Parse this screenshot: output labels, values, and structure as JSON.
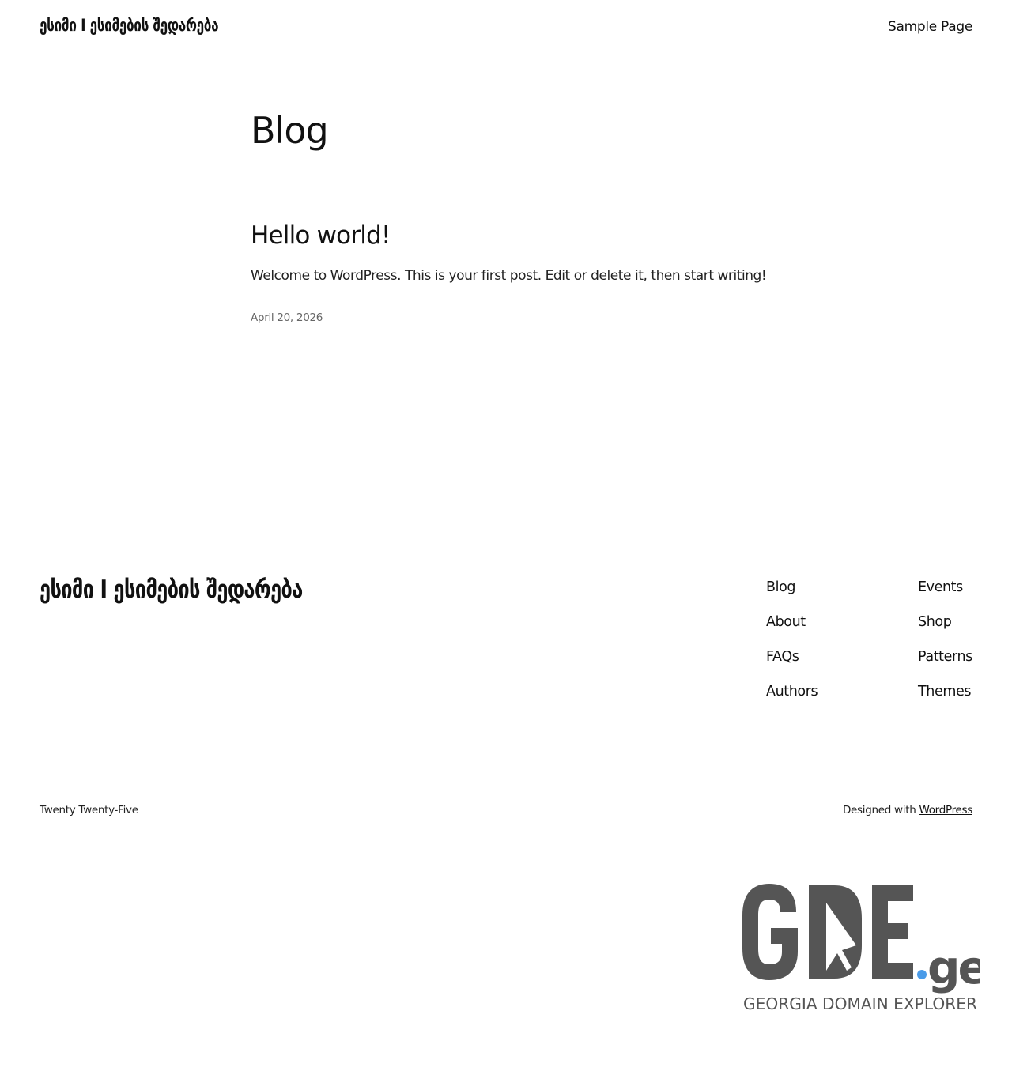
{
  "header": {
    "site_title": "ესიმი I ესიმების შედარება",
    "nav_item": "Sample Page"
  },
  "main": {
    "heading": "Blog",
    "post": {
      "title": "Hello world!",
      "excerpt": "Welcome to WordPress. This is your first post. Edit or delete it, then start writing!",
      "date": "April 20, 2026"
    }
  },
  "footer": {
    "site_title": "ესიმი I ესიმების შედარება",
    "nav_col_1": [
      "Blog",
      "About",
      "FAQs",
      "Authors"
    ],
    "nav_col_2": [
      "Events",
      "Shop",
      "Patterns",
      "Themes"
    ],
    "theme_credit": "Twenty Twenty-Five",
    "designed_with_text": "Designed with",
    "designed_with_link": "WordPress"
  },
  "logo": {
    "letters": "GDE",
    "dot": ".",
    "tld": "ge",
    "tagline": "GEORGIA DOMAIN EXPLORER",
    "primary_color": "#555555",
    "accent_color": "#4a9be8",
    "icon": "cursor-arrow-icon"
  }
}
